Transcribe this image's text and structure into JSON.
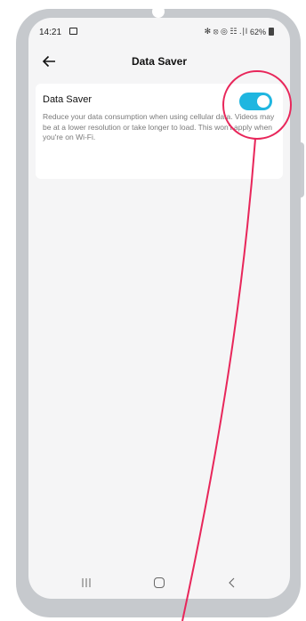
{
  "status_bar": {
    "time": "14:21",
    "icons_right": "✻ ⦻ ◎ ☷ .∣l",
    "battery": "62%"
  },
  "app_bar": {
    "back_icon": "back-arrow-icon",
    "title": "Data Saver"
  },
  "data_saver": {
    "title": "Data Saver",
    "description": "Reduce your data consumption when using cellular data. Videos may be at a lower resolution or take longer to load. This won't apply when you're on Wi-Fi.",
    "toggle_on": true
  },
  "nav_bar": {
    "items": [
      "recent-apps-icon",
      "home-icon",
      "back-icon"
    ]
  },
  "colors": {
    "toggle_accent": "#1fb6e0",
    "annotation": "#e8265a",
    "frame": "#c6c9cd",
    "screen_bg": "#f5f5f6"
  }
}
